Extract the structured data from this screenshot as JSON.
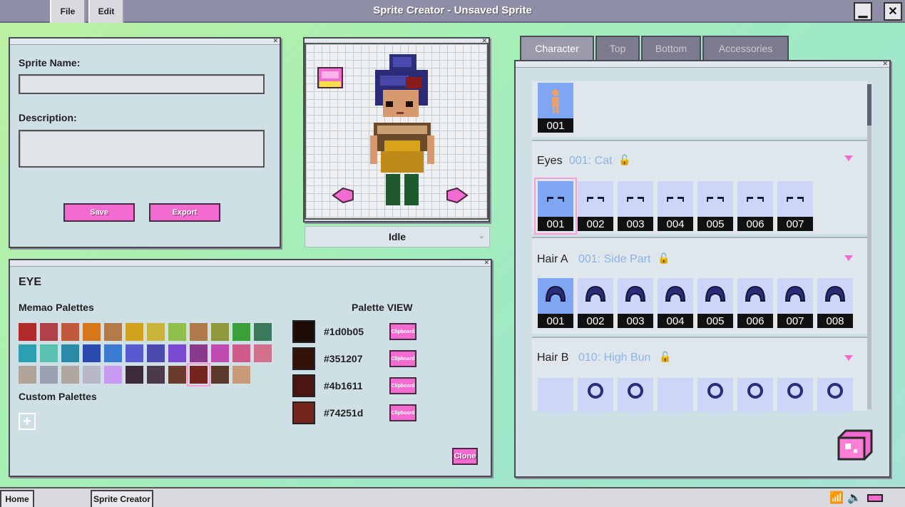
{
  "menu": {
    "file": "File",
    "edit": "Edit"
  },
  "window": {
    "title": "Sprite Creator - Unsaved Sprite",
    "minimize": "▁",
    "close": "✕"
  },
  "info_panel": {
    "name_label": "Sprite Name:",
    "name_value": "",
    "desc_label": "Description:",
    "desc_value": "",
    "save": "Save",
    "export": "Export"
  },
  "preview": {
    "animation": "Idle"
  },
  "palette_panel": {
    "title": "EYE",
    "memao_label": "Memao Palettes",
    "custom_label": "Custom Palettes",
    "view_label": "Palette VIEW",
    "colors": [
      {
        "hex": "#1d0b05",
        "clip": "Clipboard"
      },
      {
        "hex": "#351207",
        "clip": "Clipboard"
      },
      {
        "hex": "#4b1611",
        "clip": "Clipboard"
      },
      {
        "hex": "#74251d",
        "clip": "Clipboard"
      }
    ],
    "clone": "Clone"
  },
  "tabs": [
    "Character",
    "Top",
    "Bottom",
    "Accessories"
  ],
  "body_section": {
    "items": [
      "001"
    ]
  },
  "eyes": {
    "title": "Eyes",
    "selected": "001: Cat",
    "items": [
      "001",
      "002",
      "003",
      "004",
      "005",
      "006",
      "007"
    ]
  },
  "hair_a": {
    "title": "Hair A",
    "selected": "001: Side Part",
    "items": [
      "001",
      "002",
      "003",
      "004",
      "005",
      "006",
      "007",
      "008"
    ]
  },
  "hair_b": {
    "title": "Hair B",
    "selected": "010: High Bun"
  },
  "taskbar": {
    "home": "Home",
    "app": "Sprite Creator"
  }
}
